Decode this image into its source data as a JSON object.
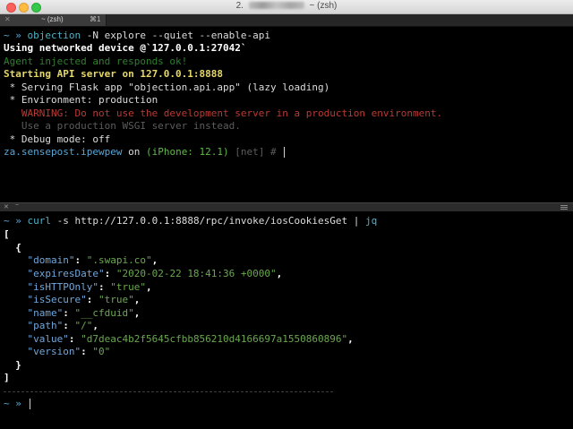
{
  "window": {
    "title_prefix": "2.",
    "title_suffix": "~ (zsh)"
  },
  "tab": {
    "close": "✕",
    "label": "~ (zsh)",
    "shortcut": "⌘1"
  },
  "divider": {
    "close": "✕",
    "label": "~"
  },
  "top_pane": {
    "l1": {
      "prompt": "~ »",
      "cmd": "objection",
      "args": " -N explore --quiet --enable-api"
    },
    "l2": "Using networked device @`127.0.0.1:27042`",
    "l3": "Agent injected and responds ok!",
    "l4": "Starting API server on 127.0.0.1:8888",
    "l5": " * Serving Flask app \"objection.api.app\" (lazy loading)",
    "l6": " * Environment: production",
    "l7": "   WARNING: Do not use the development server in a production environment.",
    "l8": "   Use a production WSGI server instead.",
    "l9": " * Debug mode: off",
    "l10": {
      "app": "za.sensepost.ipewpew",
      "on": " on ",
      "device": "(iPhone: 12.1)",
      "net": " [net] # "
    }
  },
  "bottom_pane": {
    "cmd_line": {
      "prompt": "~ »",
      "cmd": "curl",
      "args": " -s http://127.0.0.1:8888/rpc/invoke/iosCookiesGet | ",
      "jq": "jq"
    },
    "json_open": "[",
    "obj_open": "  {",
    "fields": [
      {
        "key": "\"domain\"",
        "value": "\".swapi.co\"",
        "comma": ","
      },
      {
        "key": "\"expiresDate\"",
        "value": "\"2020-02-22 18:41:36 +0000\"",
        "comma": ","
      },
      {
        "key": "\"isHTTPOnly\"",
        "value": "\"true\"",
        "comma": ","
      },
      {
        "key": "\"isSecure\"",
        "value": "\"true\"",
        "comma": ","
      },
      {
        "key": "\"name\"",
        "value": "\"__cfduid\"",
        "comma": ","
      },
      {
        "key": "\"path\"",
        "value": "\"/\"",
        "comma": ","
      },
      {
        "key": "\"value\"",
        "value": "\"d7deac4b2f5645cfbb856210d4166697a1550860896\"",
        "comma": ","
      },
      {
        "key": "\"version\"",
        "value": "\"0\"",
        "comma": ""
      }
    ],
    "obj_close": "  }",
    "json_close": "]",
    "last_prompt": "~ »"
  },
  "colors": {
    "background": "#000000",
    "prompt": "#5aa6d6",
    "warning": "#b83a34",
    "api_server": "#e5d86a",
    "json_key": "#6fa7dc",
    "json_string": "#6aa84f"
  }
}
